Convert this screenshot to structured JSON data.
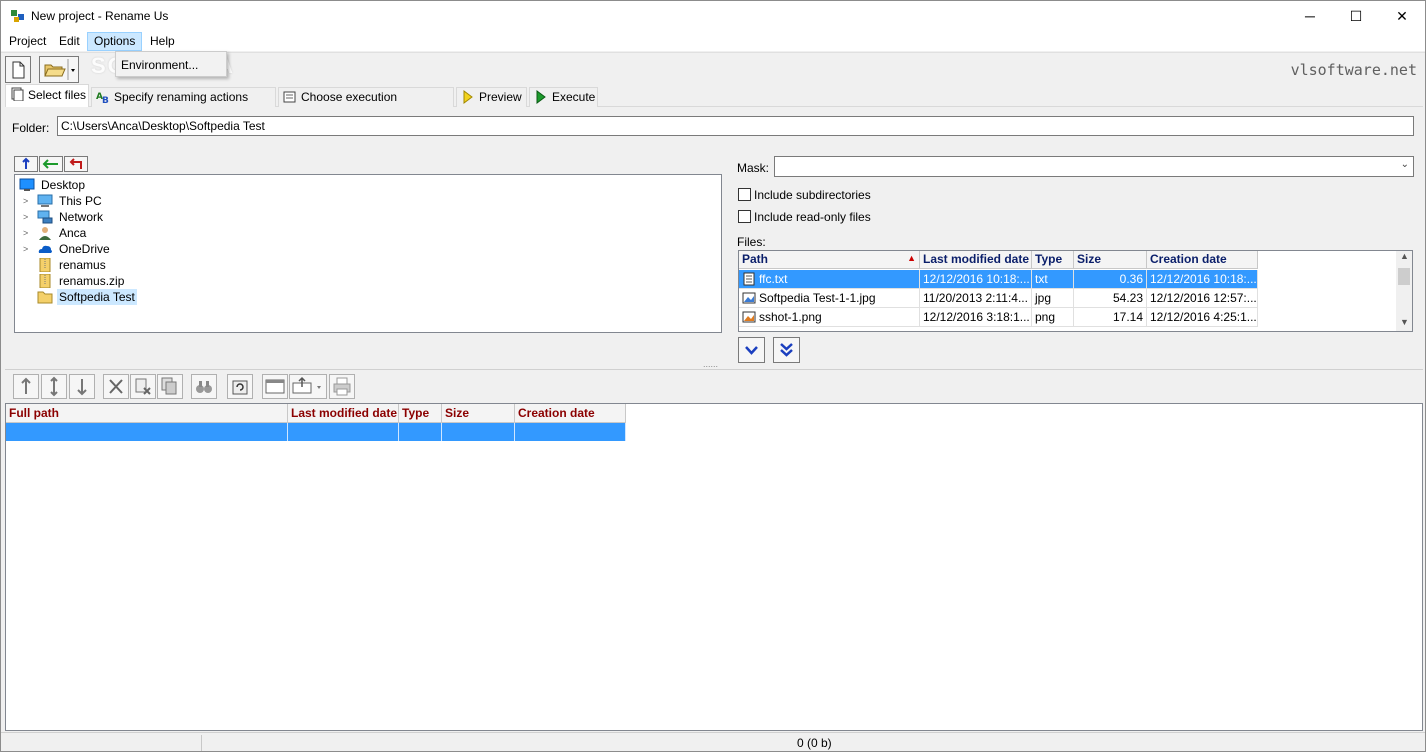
{
  "window": {
    "title": "New project - Rename Us",
    "minimize": "─",
    "maximize": "☐",
    "close": "✕"
  },
  "menu": {
    "items": [
      "Project",
      "Edit",
      "Options",
      "Help"
    ],
    "active": "Options",
    "dropdown": [
      "Environment..."
    ]
  },
  "toolbar": {
    "brand": "vlsoftware.net",
    "watermark": "SOFTPEDIA"
  },
  "tabs": [
    {
      "label": "Select files",
      "icon": "files-icon"
    },
    {
      "label": "Specify renaming actions (rules)",
      "icon": "rules-icon"
    },
    {
      "label": "Choose execution parameters",
      "icon": "parameters-icon"
    },
    {
      "label": "Preview",
      "icon": "preview-icon"
    },
    {
      "label": "Execute",
      "icon": "execute-icon"
    }
  ],
  "folder": {
    "label": "Folder:",
    "value": "C:\\Users\\Anca\\Desktop\\Softpedia Test"
  },
  "tree": {
    "nodes": [
      {
        "label": "Desktop",
        "icon": "desktop-icon",
        "expandable": false
      },
      {
        "label": "This PC",
        "icon": "computer-icon",
        "expandable": true
      },
      {
        "label": "Network",
        "icon": "network-icon",
        "expandable": true
      },
      {
        "label": "Anca",
        "icon": "user-icon",
        "expandable": true
      },
      {
        "label": "OneDrive",
        "icon": "cloud-icon",
        "expandable": true
      },
      {
        "label": "renamus",
        "icon": "zip-folder-icon",
        "expandable": false
      },
      {
        "label": "renamus.zip",
        "icon": "zip-folder-icon",
        "expandable": false
      },
      {
        "label": "Softpedia Test",
        "icon": "folder-icon",
        "expandable": false,
        "selected": true
      }
    ]
  },
  "mask": {
    "label": "Mask:",
    "value": ""
  },
  "options": {
    "include_subdirectories": "Include subdirectories",
    "include_readonly": "Include read-only files"
  },
  "files": {
    "label": "Files:",
    "columns": [
      "Path",
      "Last modified date",
      "Type",
      "Size",
      "Creation date"
    ],
    "rows": [
      {
        "path": "ffc.txt",
        "modified": "12/12/2016 10:18:...",
        "type": "txt",
        "size": "0.36",
        "created": "12/12/2016 10:18:...",
        "selected": true
      },
      {
        "path": "Softpedia Test-1-1.jpg",
        "modified": "11/20/2013 2:11:4...",
        "type": "jpg",
        "size": "54.23",
        "created": "12/12/2016 12:57:..."
      },
      {
        "path": "sshot-1.png",
        "modified": "12/12/2016 3:18:1...",
        "type": "png",
        "size": "17.14",
        "created": "12/12/2016 4:25:1..."
      }
    ]
  },
  "queue": {
    "columns": [
      "Full path",
      "Last modified date",
      "Type",
      "Size",
      "Creation date"
    ]
  },
  "status": {
    "text": "0  (0 b)"
  }
}
